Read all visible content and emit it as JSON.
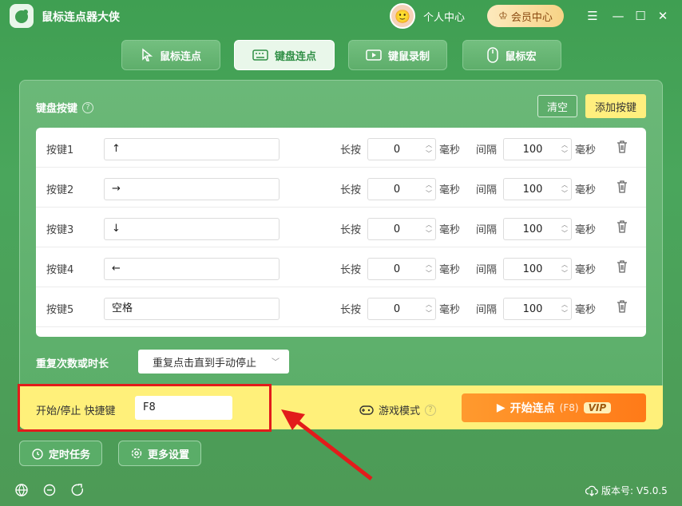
{
  "app": {
    "title": "鼠标连点器大侠"
  },
  "header": {
    "personal_label": "个人中心",
    "vip_label": "会员中心"
  },
  "tabs": [
    {
      "label": "鼠标连点",
      "icon": "cursor-icon"
    },
    {
      "label": "键盘连点",
      "icon": "keyboard-icon",
      "active": true
    },
    {
      "label": "键鼠录制",
      "icon": "record-icon"
    },
    {
      "label": "鼠标宏",
      "icon": "mouse-icon"
    }
  ],
  "section": {
    "title": "键盘按键",
    "clear_label": "清空",
    "add_label": "添加按键"
  },
  "columns": {
    "hold_label": "长按",
    "interval_label": "间隔",
    "unit": "毫秒"
  },
  "keys": [
    {
      "label": "按键1",
      "key": "↑",
      "hold": "0",
      "interval": "100"
    },
    {
      "label": "按键2",
      "key": "→",
      "hold": "0",
      "interval": "100"
    },
    {
      "label": "按键3",
      "key": "↓",
      "hold": "0",
      "interval": "100"
    },
    {
      "label": "按键4",
      "key": "←",
      "hold": "0",
      "interval": "100"
    },
    {
      "label": "按键5",
      "key": "空格",
      "hold": "0",
      "interval": "100"
    }
  ],
  "repeat": {
    "label": "重复次数或时长",
    "value": "重复点击直到手动停止"
  },
  "hotkey": {
    "label": "开始/停止 快捷键",
    "value": "F8"
  },
  "game_mode": {
    "label": "游戏模式"
  },
  "start": {
    "label": "开始连点",
    "hint": "(F8)",
    "vip": "VIP"
  },
  "bottom": {
    "timer_label": "定时任务",
    "settings_label": "更多设置"
  },
  "footer": {
    "version_label": "版本号:",
    "version": "V5.0.5"
  },
  "colors": {
    "brand_green": "#4aa65c",
    "start_orange": "#ff8a22",
    "highlight_red": "#e21b1b",
    "yellow": "#fff07a"
  }
}
